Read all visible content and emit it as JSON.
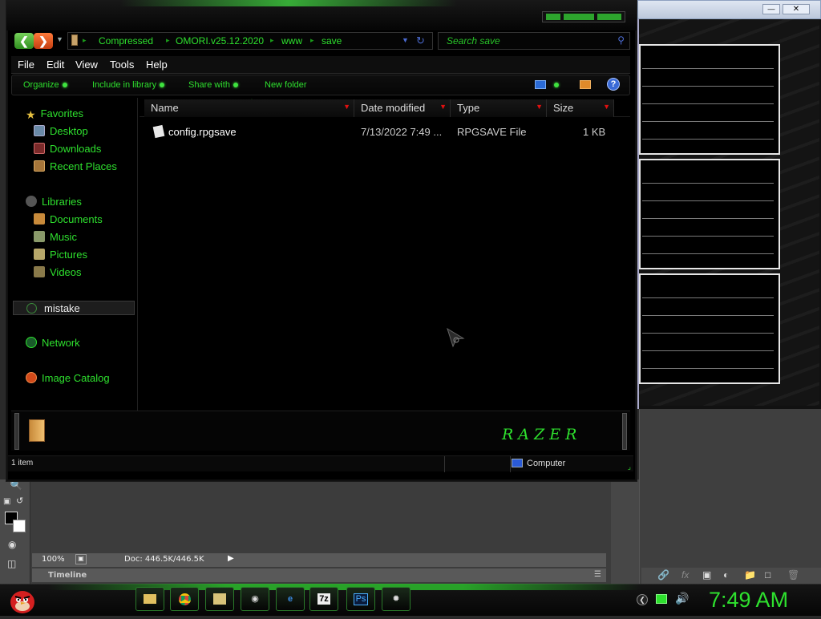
{
  "explorer": {
    "breadcrumb": [
      "Compressed",
      "OMORI.v25.12.2020",
      "www",
      "save"
    ],
    "search_placeholder": "Search save",
    "menu": [
      "File",
      "Edit",
      "View",
      "Tools",
      "Help"
    ],
    "commands": [
      "Organize",
      "Include in library",
      "Share with",
      "New folder"
    ],
    "nav": {
      "favorites_label": "Favorites",
      "favorites": [
        "Desktop",
        "Downloads",
        "Recent Places"
      ],
      "libraries_label": "Libraries",
      "libraries": [
        "Documents",
        "Music",
        "Pictures",
        "Videos"
      ],
      "selected_item": "mistake",
      "network": "Network",
      "image_catalog": "Image Catalog"
    },
    "columns": [
      "Name",
      "Date modified",
      "Type",
      "Size"
    ],
    "files": [
      {
        "name": "config.rpgsave",
        "date": "7/13/2022 7:49 ...",
        "type": "RPGSAVE File",
        "size": "1 KB"
      }
    ],
    "status": {
      "count": "1 item",
      "location": "Computer"
    },
    "brand_text": "RAZER"
  },
  "photoshop": {
    "zoom": "100%",
    "doc_info": "Doc: 446.5K/446.5K",
    "timeline_label": "Timeline"
  },
  "taskbar": {
    "apps": [
      "file-manager-icon",
      "chrome-icon",
      "explorer-icon",
      "media-icon",
      "ie-icon",
      "7zip-icon",
      "photoshop-icon",
      "bug-icon"
    ],
    "app_labels": {
      "sevenzip": "7z",
      "photoshop": "Ps"
    },
    "clock": "7:49 AM"
  },
  "colors": {
    "accent": "#2ee02e",
    "sort_arrow": "#e01010",
    "background": "#000000"
  }
}
